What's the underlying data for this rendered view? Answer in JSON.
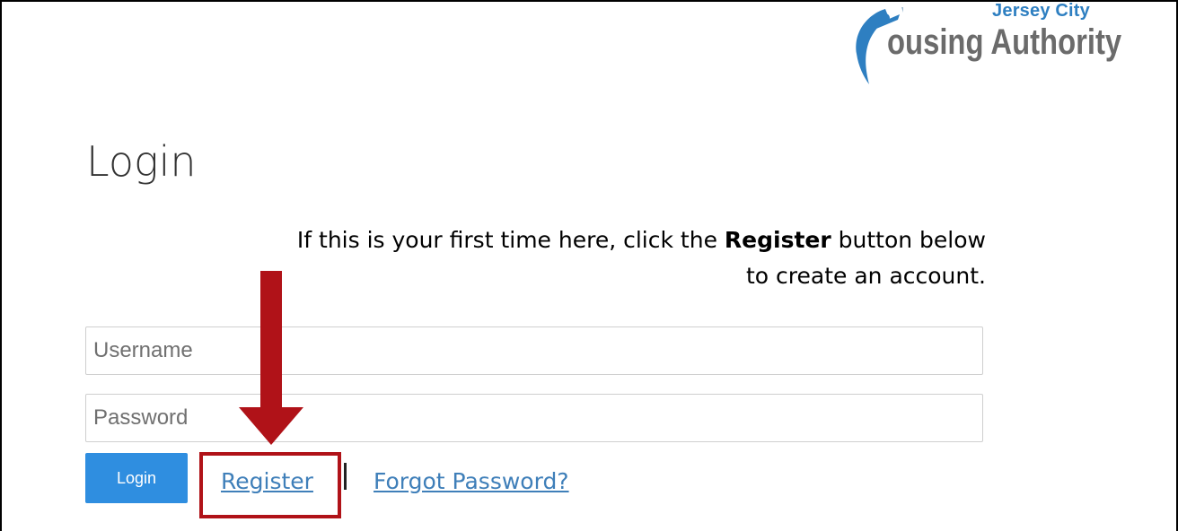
{
  "header": {
    "logo_line1": "Jersey City",
    "logo_line2": "ousing Authority",
    "logo_icon": "person-swoosh-icon",
    "brand_blue": "#2e7fc1",
    "brand_gray": "#6b6b6b"
  },
  "main": {
    "title": "Login",
    "instruction_prefix": "If this is your first time here, click the ",
    "instruction_bold": "Register",
    "instruction_middle": " button below",
    "instruction_suffix": "to create an account."
  },
  "form": {
    "username_placeholder": "Username",
    "username_value": "",
    "password_placeholder": "Password",
    "password_value": "",
    "login_label": "Login",
    "register_label": "Register",
    "forgot_label": "Forgot Password?"
  },
  "annotation": {
    "arrow_icon": "down-arrow-icon",
    "highlight_color": "#b01218",
    "button_color": "#2f8ee0"
  }
}
